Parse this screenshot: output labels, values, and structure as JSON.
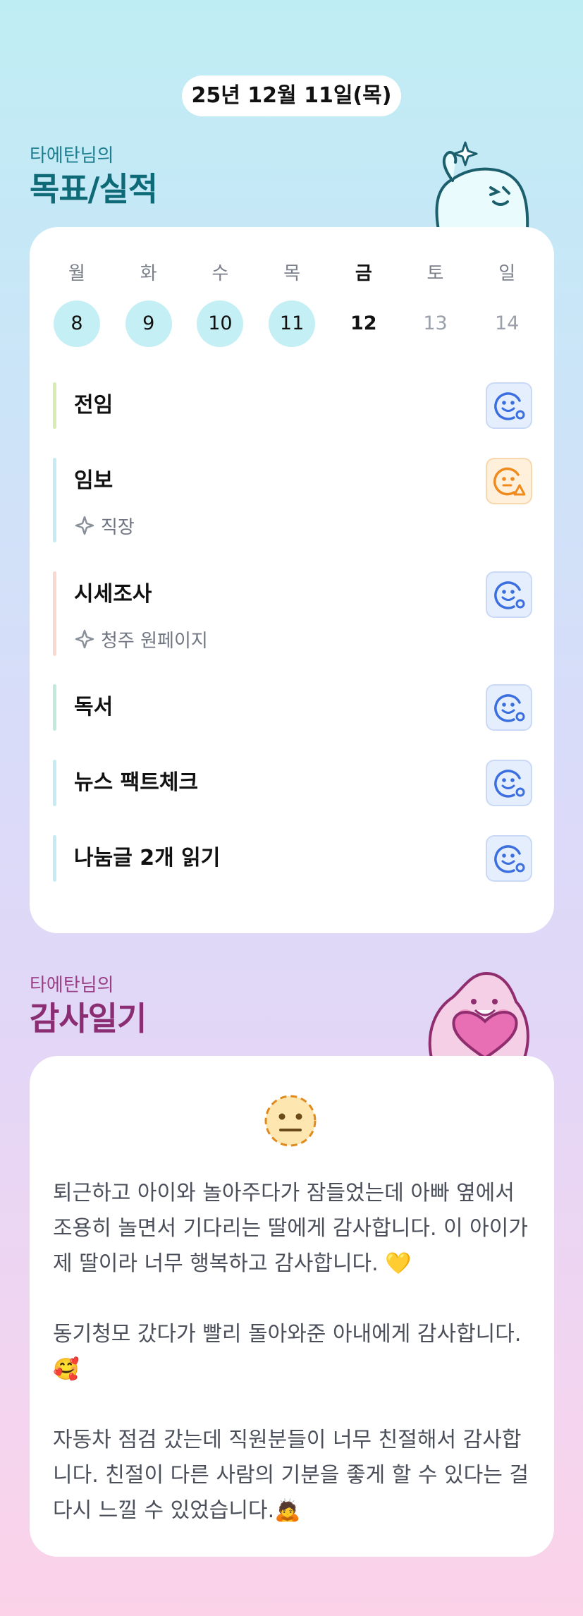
{
  "date": "25년 12월 11일(목)",
  "goals_section": {
    "subtitle": "타에탄님의",
    "title": "목표/실적"
  },
  "week": [
    {
      "name": "월",
      "num": "8",
      "state": "done"
    },
    {
      "name": "화",
      "num": "9",
      "state": "done"
    },
    {
      "name": "수",
      "num": "10",
      "state": "done"
    },
    {
      "name": "목",
      "num": "11",
      "state": "done"
    },
    {
      "name": "금",
      "num": "12",
      "state": "today"
    },
    {
      "name": "토",
      "num": "13",
      "state": "future"
    },
    {
      "name": "일",
      "num": "14",
      "state": "future"
    }
  ],
  "goals": [
    {
      "title": "전임",
      "sub": "",
      "bar_color": "#d6ecb0",
      "status": "smile-blue-icon"
    },
    {
      "title": "임보",
      "sub": "직장",
      "bar_color": "#c6ecf3",
      "status": "meh-warning-orange-icon"
    },
    {
      "title": "시세조사",
      "sub": "청주 원페이지",
      "bar_color": "#f9d9cf",
      "status": "smile-blue-icon"
    },
    {
      "title": "독서",
      "sub": "",
      "bar_color": "#bfeadc",
      "status": "smile-blue-icon"
    },
    {
      "title": "뉴스 팩트체크",
      "sub": "",
      "bar_color": "#c6ecf3",
      "status": "smile-blue-icon"
    },
    {
      "title": "나눔글 2개 읽기",
      "sub": "",
      "bar_color": "#c6ecf3",
      "status": "smile-blue-icon"
    }
  ],
  "diary_section": {
    "subtitle": "타에탄님의",
    "title": "감사일기"
  },
  "diary": {
    "mood": "neutral-face-icon",
    "paragraphs": [
      "퇴근하고 아이와 놀아주다가 잠들었는데 아빠 옆에서 조용히 놀면서 기다리는 딸에게 감사합니다. 이 아이가 제 딸이라 너무 행복하고 감사합니다. 💛",
      "동기청모 갔다가 빨리 돌아와준 아내에게 감사합니다. 🥰",
      "자동차 점검 갔는데 직원분들이 너무 친절해서 감사합니다. 친절이 다른 사람의 기분을 좋게 할 수 있다는 걸 다시 느낄 수 있었습니다.🙇"
    ]
  },
  "colors": {
    "accent_teal": "#1d7f8f",
    "accent_plum": "#9a3f86",
    "done_day": "#c4eff5",
    "status_blue": "#3b6fe0",
    "status_orange": "#f08a1c"
  }
}
